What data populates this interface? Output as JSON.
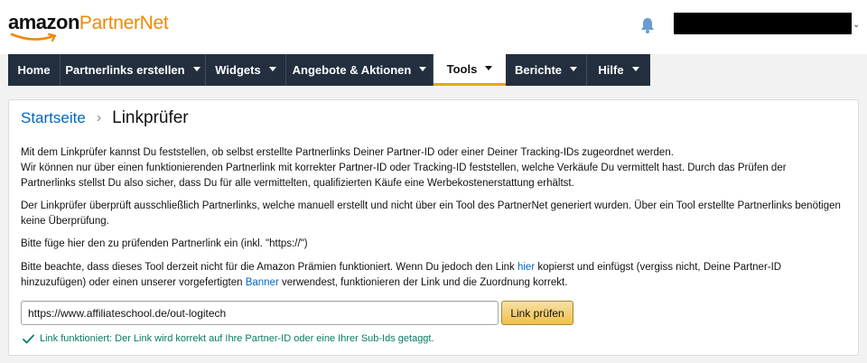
{
  "brand": {
    "logo_amazon": "amazon",
    "logo_partner": "PartnerNet",
    "accent_color": "#f08804"
  },
  "header": {
    "bell_icon": "bell-icon",
    "account_chevron": "⌄"
  },
  "nav": {
    "items": [
      {
        "label": "Home",
        "has_dropdown": false
      },
      {
        "label": "Partnerlinks erstellen",
        "has_dropdown": true
      },
      {
        "label": "Widgets",
        "has_dropdown": true
      },
      {
        "label": "Angebote & Aktionen",
        "has_dropdown": true
      },
      {
        "label": "Tools",
        "has_dropdown": true,
        "active": true
      },
      {
        "label": "Berichte",
        "has_dropdown": true
      },
      {
        "label": "Hilfe",
        "has_dropdown": true
      }
    ],
    "background_color": "#232f3e",
    "active_underline_color": "#f0a500"
  },
  "breadcrumb": {
    "home": "Startseite",
    "separator": "›",
    "current": "Linkprüfer"
  },
  "content": {
    "intro_line1": "Mit dem Linkprüfer kannst Du feststellen, ob selbst erstellte Partnerlinks Deiner Partner-ID oder einer Deiner Tracking-IDs zugeordnet werden.",
    "intro_line2": "Wir können nur über einen funktionierenden Partnerlink mit korrekter Partner-ID oder Tracking-ID feststellen, welche Verkäufe Du vermittelt hast. Durch das Prüfen der Partnerlinks stellst Du also sicher, dass Du für alle vermittelten, qualifizierten Käufe eine Werbekostenerstattung erhältst.",
    "para2": "Der Linkprüfer überprüft ausschließlich Partnerlinks, welche manuell erstellt und nicht über ein Tool des PartnerNet generiert wurden. Über ein Tool erstellte Partnerlinks benötigen keine Überprüfung.",
    "para3": "Bitte füge hier den zu prüfenden Partnerlink ein (inkl. \"https://\")",
    "para4_a": "Bitte beachte, dass dieses Tool derzeit nicht für die Amazon Prämien funktioniert. Wenn Du jedoch den Link ",
    "para4_link1": "hier",
    "para4_b": " kopierst und einfügst (vergiss nicht, Deine Partner-ID hinzuzufügen) oder einen unserer vorgefertigten ",
    "para4_link2": "Banner",
    "para4_c": " verwendest, funktionieren der Link und die Zuordnung korrekt."
  },
  "form": {
    "url_value": "https://www.affiliateschool.de/out-logitech",
    "button_label": "Link prüfen"
  },
  "status": {
    "message": "Link funktioniert: Der Link wird korrekt auf Ihre Partner-ID oder eine Ihrer Sub-Ids getaggt.",
    "color": "#067d62"
  }
}
